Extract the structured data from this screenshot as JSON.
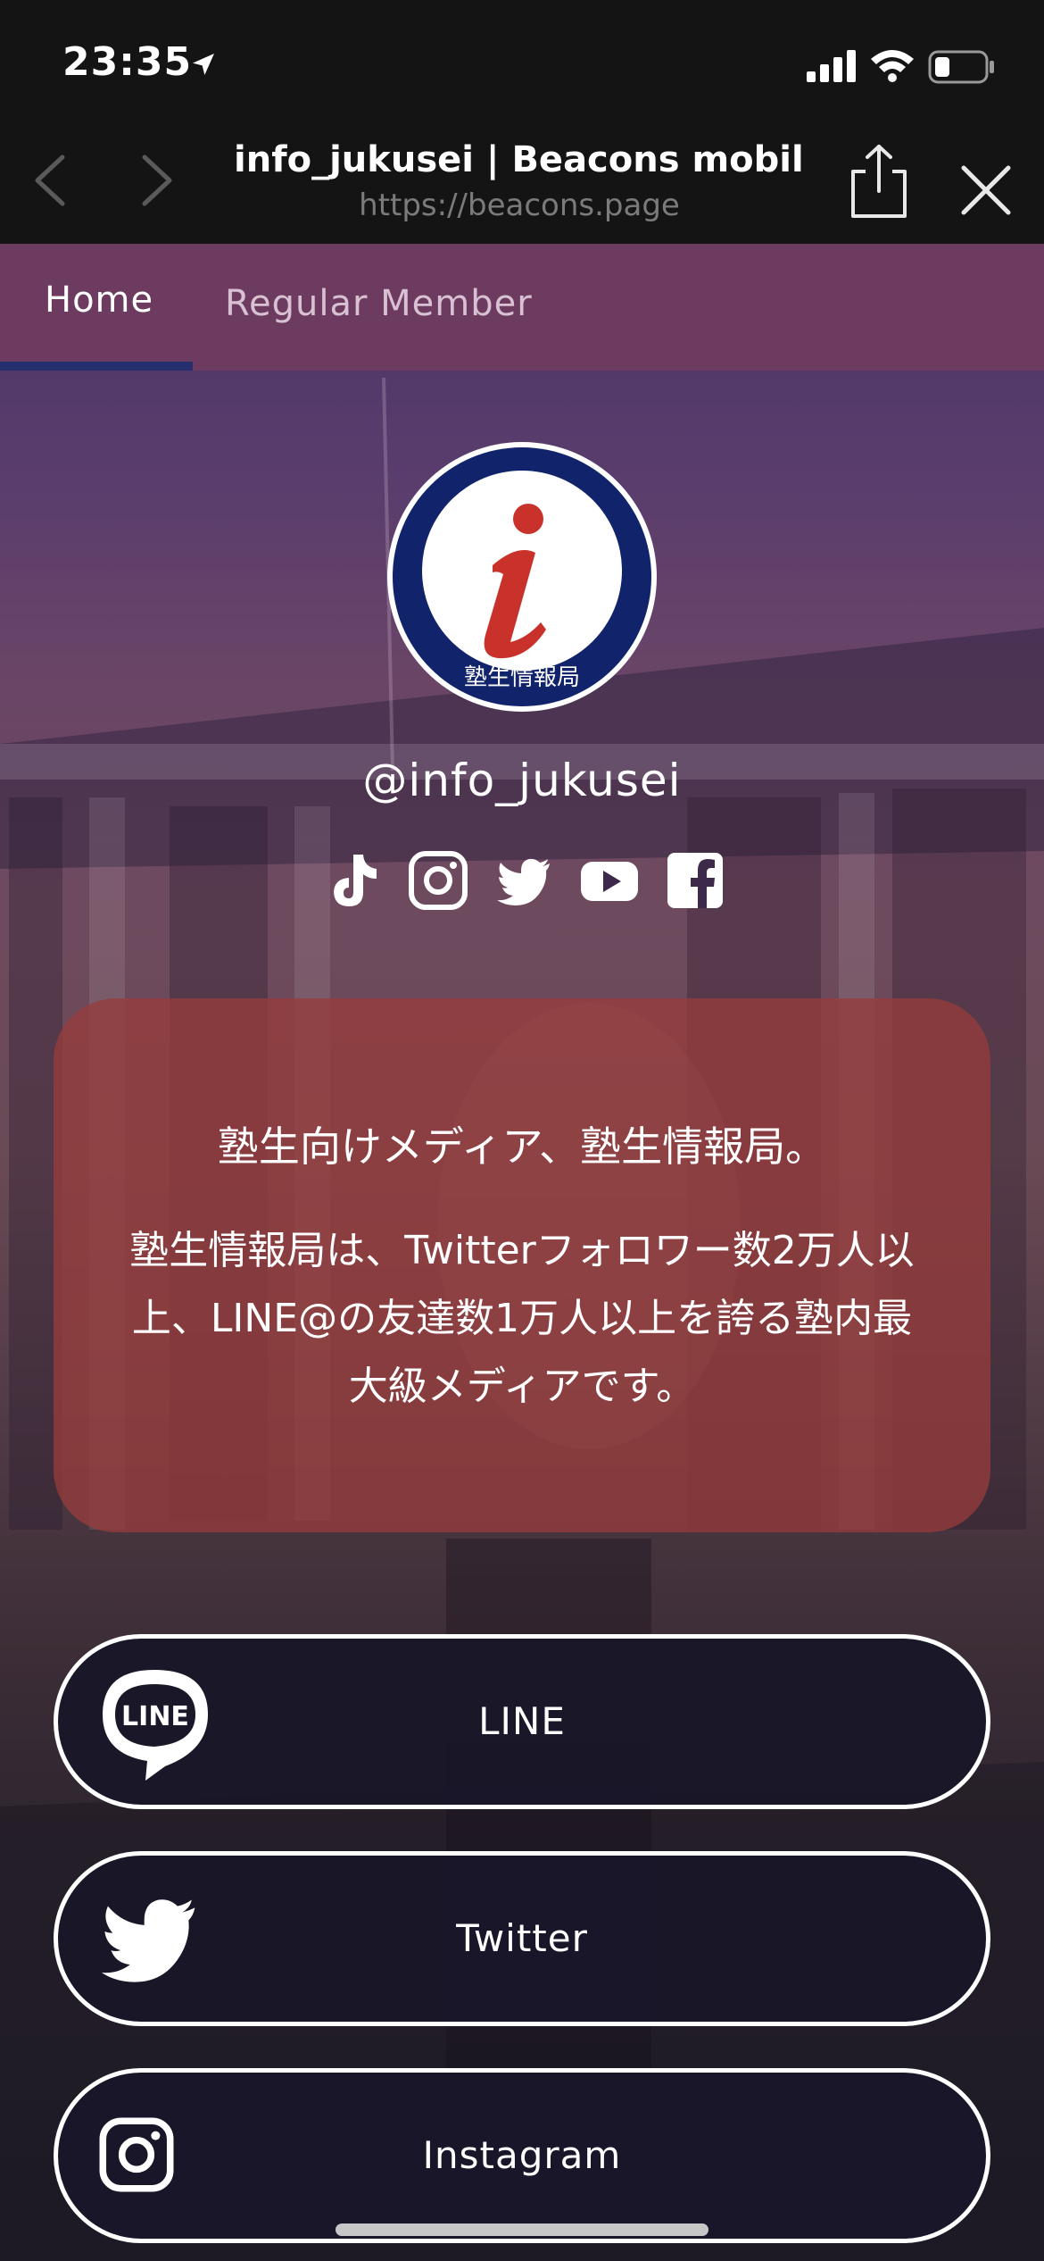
{
  "status_bar": {
    "time": "23:35",
    "icons": [
      "location-arrow-icon",
      "cellular-signal-icon",
      "wifi-icon",
      "battery-icon"
    ]
  },
  "browser": {
    "title": "info_jukusei | Beacons mobile...",
    "url": "https://beacons.page",
    "icons": [
      "back-icon",
      "forward-icon",
      "share-icon",
      "close-icon"
    ]
  },
  "tabs": [
    {
      "label": "Home",
      "active": true
    },
    {
      "label": "Regular Member",
      "active": false
    }
  ],
  "profile": {
    "avatar_text": "塾生情報局",
    "avatar_letter": "i",
    "handle": "@info_jukusei"
  },
  "socials": [
    "tiktok-icon",
    "instagram-icon",
    "twitter-icon",
    "youtube-icon",
    "facebook-icon"
  ],
  "bio": {
    "line1": "塾生向けメディア、塾生情報局。",
    "line2": "塾生情報局は、Twitterフォロワー数2万人以上、LINE@の友達数1万人以上を誇る塾内最大級メディアです。"
  },
  "links": [
    {
      "label": "LINE",
      "icon": "line-icon",
      "icon_text": "LINE"
    },
    {
      "label": "Twitter",
      "icon": "twitter-icon"
    },
    {
      "label": "Instagram",
      "icon": "instagram-icon"
    }
  ],
  "colors": {
    "tab_bar": "#6c3b5f",
    "tab_underline": "#27306e",
    "bio_card": "#963c3c",
    "avatar_ring": "#11236b",
    "avatar_letter": "#c8322a"
  }
}
